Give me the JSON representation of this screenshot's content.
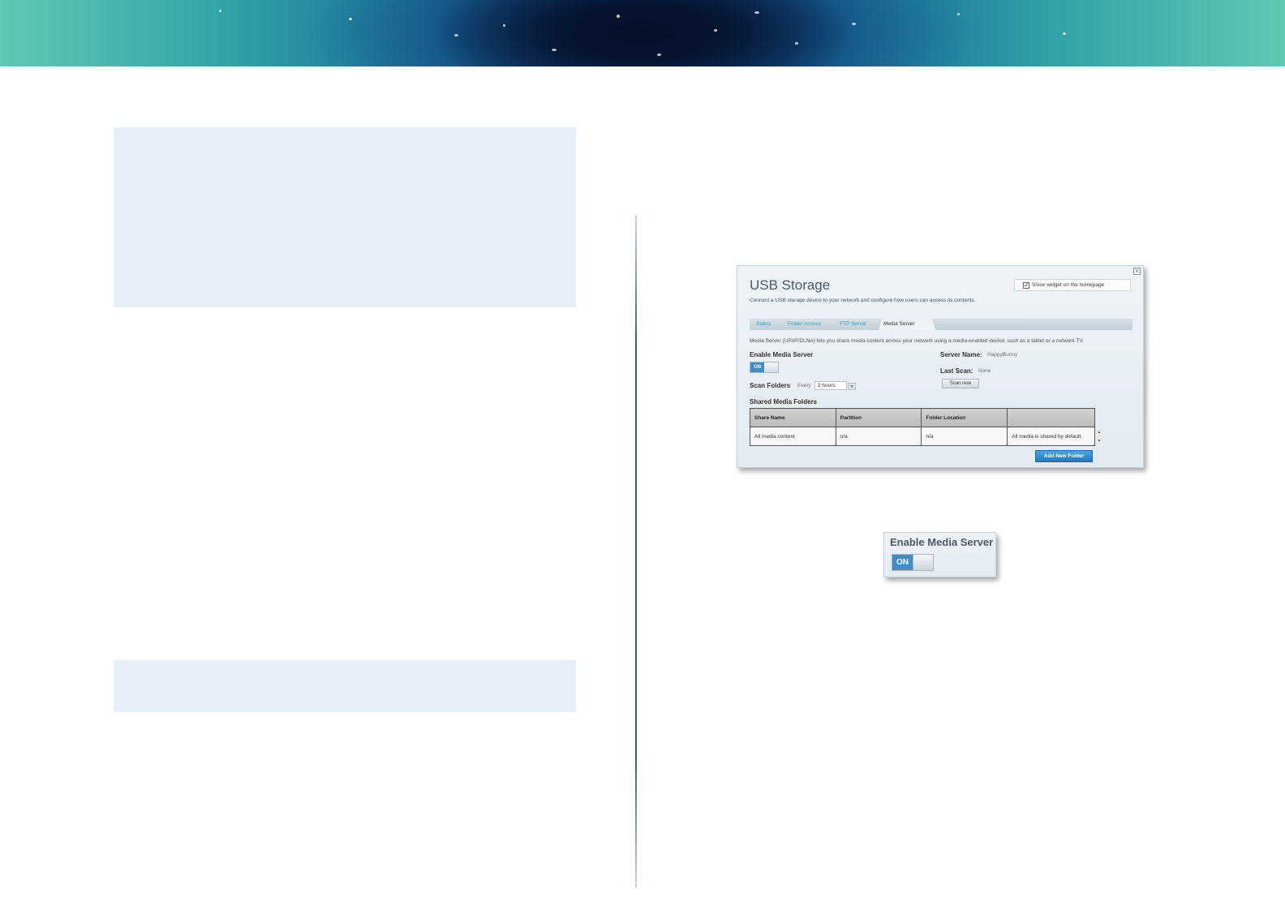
{
  "screenshot": {
    "title": "USB Storage",
    "subtitle": "Connect a USB storage device to your network and configure how users can access its contents.",
    "widget_checkbox_label": "Show widget on the homepage",
    "widget_checked": true,
    "close_glyph": "×",
    "tabs": [
      {
        "label": "Status",
        "active": false
      },
      {
        "label": "Folder Access",
        "active": false
      },
      {
        "label": "FTP Server",
        "active": false
      },
      {
        "label": "Media Server",
        "active": true
      }
    ],
    "description": "Media Server (UPnP/DLNA) lets you share media content across your network using a media-enabled device, such as a tablet or a network TV.",
    "enable_media_server_label": "Enable Media Server",
    "toggle_on_label": "ON",
    "server_name_label": "Server Name:",
    "server_name_value": "HappyBunny",
    "last_scan_label": "Last Scan:",
    "last_scan_value": "None",
    "scan_now_label": "Scan now",
    "scan_folders_label": "Scan Folders",
    "scan_every_label": "Every",
    "scan_interval_value": "2 hours",
    "shared_media_folders_label": "Shared Media Folders",
    "table": {
      "headers": [
        "Share Name",
        "Partition",
        "Folder Location",
        ""
      ],
      "rows": [
        [
          "All media content",
          "n/a",
          "n/a",
          "All media is shared by default."
        ]
      ]
    },
    "add_folder_label": "Add New Folder"
  },
  "zoom": {
    "label": "Enable Media Server",
    "toggle_on_label": "ON"
  },
  "colors": {
    "accent_blue": "#3f8fc6",
    "tab_link": "#2aa0c8",
    "note_box": "#e8eef8"
  },
  "icons": {
    "checkbox": "check-icon",
    "close": "close-icon",
    "dropdown": "chevron-down-icon"
  }
}
